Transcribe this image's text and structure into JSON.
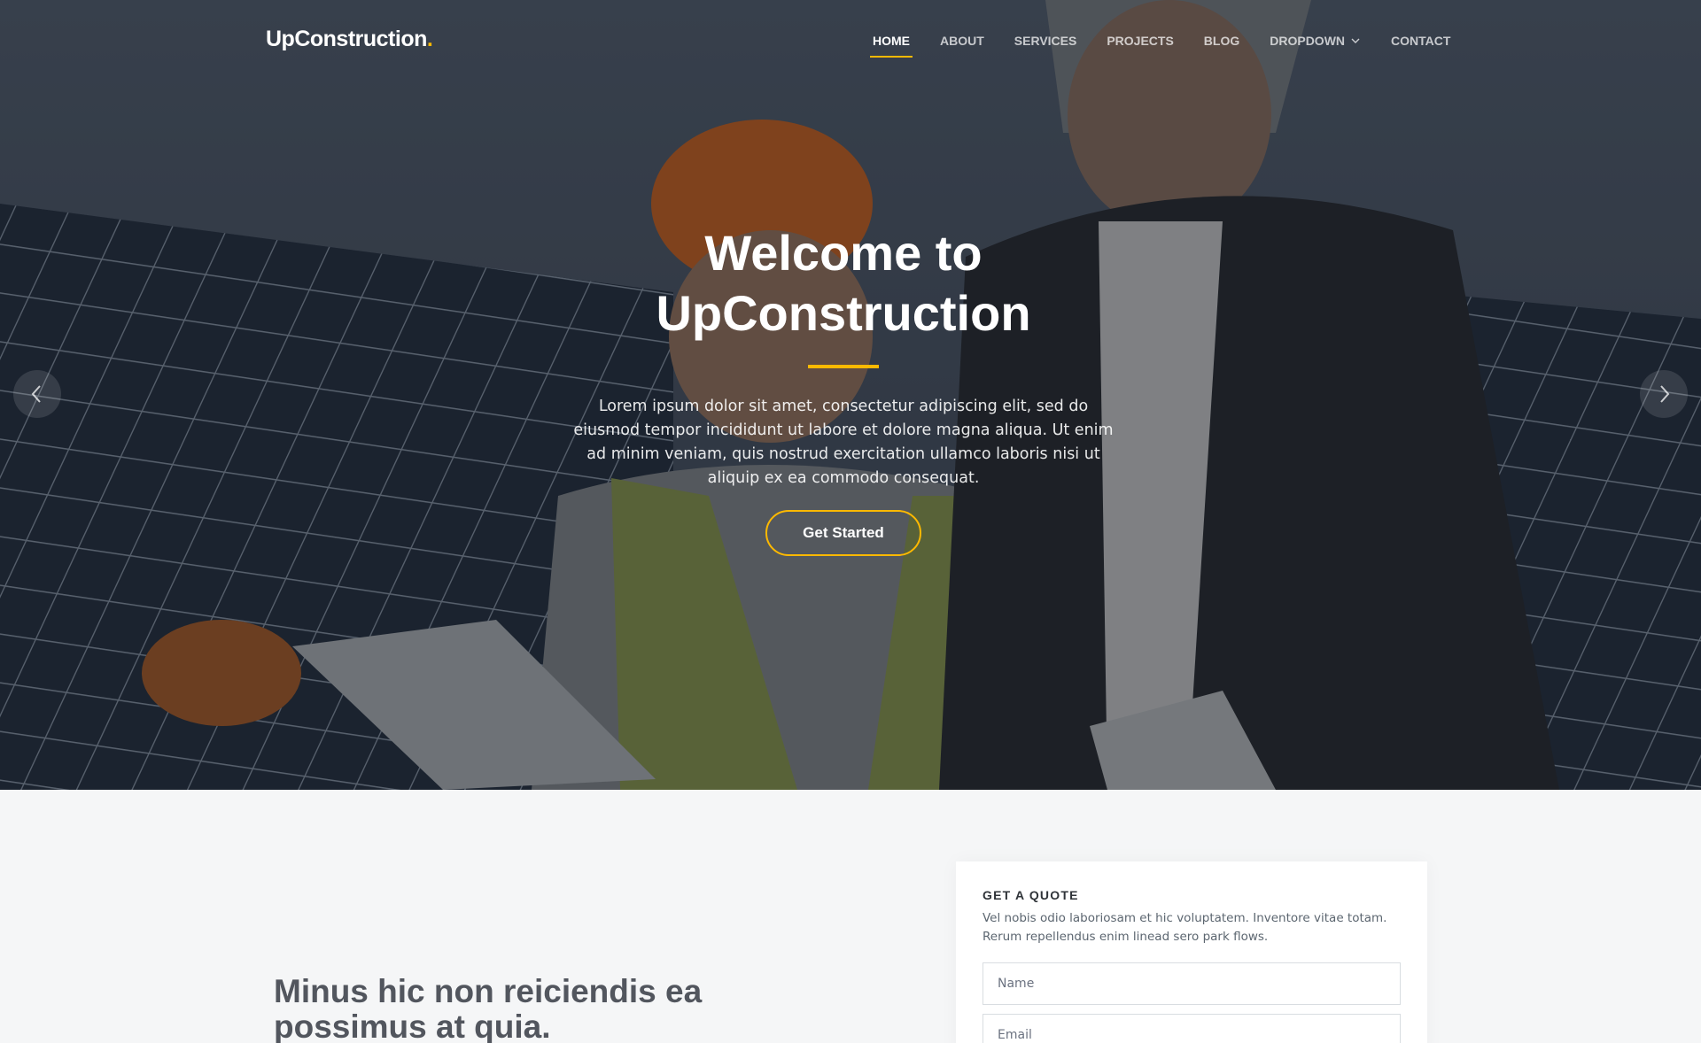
{
  "header": {
    "logo_text": "UpConstruction",
    "logo_dot": ".",
    "nav": [
      {
        "label": "HOME",
        "active": true
      },
      {
        "label": "ABOUT",
        "active": false
      },
      {
        "label": "SERVICES",
        "active": false
      },
      {
        "label": "PROJECTS",
        "active": false
      },
      {
        "label": "BLOG",
        "active": false
      },
      {
        "label": "DROPDOWN",
        "active": false,
        "icon": "chevron-down-icon"
      },
      {
        "label": "CONTACT",
        "active": false
      }
    ]
  },
  "hero": {
    "title_line1": "Welcome to",
    "title_line2": "UpConstruction",
    "text": "Lorem ipsum dolor sit amet, consectetur adipiscing elit, sed do eiusmod tempor incididunt ut labore et dolore magna aliqua. Ut enim ad minim veniam, quis nostrud exercitation ullamco laboris nisi ut aliquip ex ea commodo consequat.",
    "cta_label": "Get Started",
    "prev_icon": "chevron-left-icon",
    "next_icon": "chevron-right-icon"
  },
  "section": {
    "heading": "Minus hic non reiciendis ea possimus at quia."
  },
  "quote": {
    "title": "GET A QUOTE",
    "description": "Vel nobis odio laboriosam et hic voluptatem. Inventore vitae totam. Rerum repellendus enim linead sero park flows.",
    "name_placeholder": "Name",
    "email_placeholder": "Email"
  },
  "colors": {
    "accent": "#feb900",
    "hero_overlay": "#262e3a",
    "page_bg": "#f5f6f7"
  }
}
